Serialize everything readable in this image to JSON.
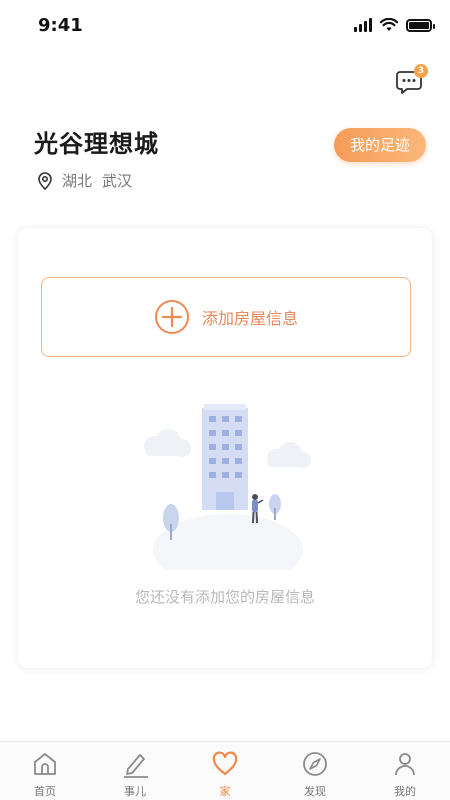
{
  "status_bar": {
    "time": "9:41"
  },
  "header": {
    "community_name": "光谷理想城",
    "province": "湖北",
    "city": "武汉",
    "footprint_button": "我的足迹",
    "message_badge_count": "3"
  },
  "card": {
    "add_house_label": "添加房屋信息",
    "empty_message": "您还没有添加您的房屋信息"
  },
  "tab_bar": {
    "items": [
      {
        "label": "首页",
        "icon": "home-icon"
      },
      {
        "label": "事儿",
        "icon": "pencil-icon"
      },
      {
        "label": "家",
        "icon": "heart-icon"
      },
      {
        "label": "发现",
        "icon": "compass-icon"
      },
      {
        "label": "我的",
        "icon": "person-icon"
      }
    ],
    "active_index": 2
  },
  "colors": {
    "accent": "#f08a4b",
    "button_gradient_start": "#f59b57",
    "button_gradient_end": "#fbb87a",
    "badge": "#f7a24a"
  }
}
